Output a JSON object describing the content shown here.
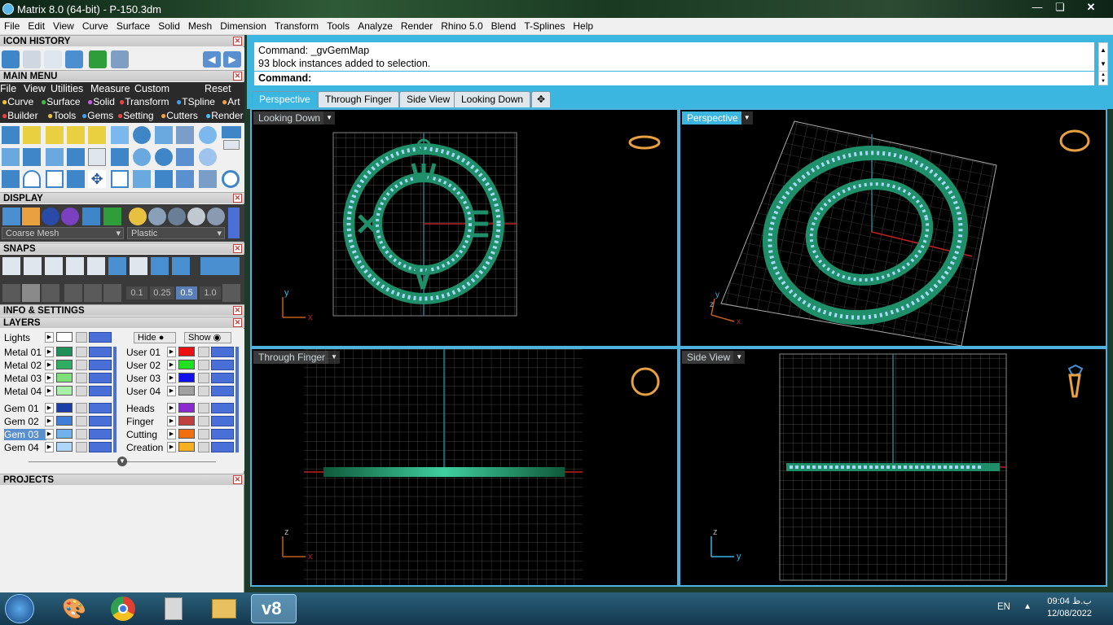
{
  "window": {
    "title": "Matrix 8.0 (64-bit) - P-150.3dm"
  },
  "menubar": [
    "File",
    "Edit",
    "View",
    "Curve",
    "Surface",
    "Solid",
    "Mesh",
    "Dimension",
    "Transform",
    "Tools",
    "Analyze",
    "Render",
    "Rhino 5.0",
    "Blend",
    "T-Splines",
    "Help"
  ],
  "panels": {
    "icon_history": "ICON HISTORY",
    "main_menu": "MAIN MENU",
    "display": "DISPLAY",
    "snaps": "SNAPS",
    "info_settings": "INFO & SETTINGS",
    "layers": "LAYERS",
    "projects": "PROJECTS"
  },
  "main_menu": {
    "top": [
      "File",
      "View",
      "Utilities",
      "Measure",
      "Custom"
    ],
    "reset": "Reset",
    "row1": [
      "Curve",
      "Surface",
      "Solid",
      "Transform",
      "TSpline",
      "Art"
    ],
    "row2": [
      "Builder",
      "Tools",
      "Gems",
      "Setting",
      "Cutters",
      "Render"
    ]
  },
  "display": {
    "mesh": "Coarse Mesh",
    "material": "Plastic"
  },
  "snaps": {
    "values": [
      "0.1",
      "0.25",
      "0.5",
      "1.0"
    ]
  },
  "layers": {
    "lights": "Lights",
    "hide": "Hide",
    "show": "Show",
    "left": [
      {
        "name": "Metal 01",
        "color": "#1f8f5a"
      },
      {
        "name": "Metal 02",
        "color": "#2fae63"
      },
      {
        "name": "Metal 03",
        "color": "#7ee07a"
      },
      {
        "name": "Metal 04",
        "color": "#a8f0a8"
      },
      {
        "name": "Gem 01",
        "color": "#1a3fa8"
      },
      {
        "name": "Gem 02",
        "color": "#3f7ed6"
      },
      {
        "name": "Gem 03",
        "color": "#6fb2ee"
      },
      {
        "name": "Gem 04",
        "color": "#aed6f8"
      }
    ],
    "right": [
      {
        "name": "User 01",
        "color": "#ee1010"
      },
      {
        "name": "User 02",
        "color": "#20e020"
      },
      {
        "name": "User 03",
        "color": "#1010ee"
      },
      {
        "name": "User 04",
        "color": "#a0a0a0"
      },
      {
        "name": "Heads",
        "color": "#8a2ad0"
      },
      {
        "name": "Finger",
        "color": "#c04040"
      },
      {
        "name": "Cutting",
        "color": "#f07010"
      },
      {
        "name": "Creation",
        "color": "#f4b020"
      }
    ],
    "selected": "Gem 03"
  },
  "command": {
    "history": [
      "Command: _gvGemMap",
      "93 block instances added to selection."
    ],
    "prompt": "Command:"
  },
  "viewport_tabs": [
    "Perspective",
    "Through Finger",
    "Side View",
    "Looking Down"
  ],
  "viewports": {
    "top_left": {
      "label": "Looking Down"
    },
    "top_right": {
      "label": "Perspective"
    },
    "bottom_left": {
      "label": "Through Finger"
    },
    "bottom_right": {
      "label": "Side View"
    }
  },
  "axes": {
    "x": "x",
    "y": "y",
    "z": "z"
  },
  "taskbar": {
    "lang": "EN",
    "time": "09:04 ب.ظ",
    "date": "12/08/2022"
  }
}
